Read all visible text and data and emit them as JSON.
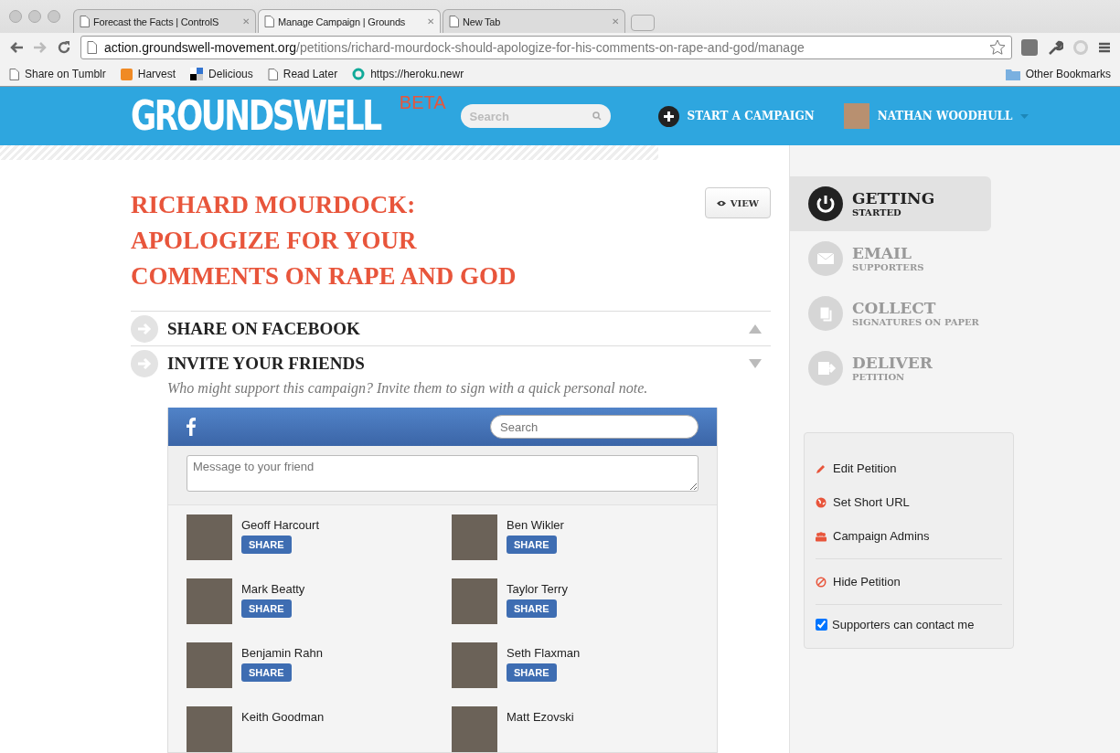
{
  "browser": {
    "tabs": [
      {
        "title": "Forecast the Facts | ControlS",
        "selected": false,
        "close": "✕"
      },
      {
        "title": "Manage Campaign | Grounds",
        "selected": true,
        "close": "✕"
      },
      {
        "title": "New Tab",
        "selected": false,
        "close": "✕"
      }
    ],
    "url": {
      "host": "action.groundswell-movement.org",
      "path": "/petitions/richard-mourdock-should-apologize-for-his-comments-on-rape-and-god/manage"
    },
    "bookmarks": [
      {
        "label": "Share on Tumblr",
        "kind": "page"
      },
      {
        "label": "Harvest",
        "kind": "harvest"
      },
      {
        "label": "Delicious",
        "kind": "delicious"
      },
      {
        "label": "Read Later",
        "kind": "page"
      },
      {
        "label": "https://heroku.newr",
        "kind": "globe"
      }
    ],
    "other_bookmarks": "Other Bookmarks"
  },
  "header": {
    "logo": "GROUNDSWELL",
    "badge": "BETA",
    "search_placeholder": "Search",
    "start_campaign": "START A CAMPAIGN",
    "user": "NATHAN WOODHULL"
  },
  "petition": {
    "title": "RICHARD MOURDOCK: APOLOGIZE FOR YOUR COMMENTS ON RAPE AND GOD",
    "view_button": "VIEW",
    "sections": [
      {
        "title": "SHARE ON FACEBOOK",
        "expanded": false
      },
      {
        "title": "INVITE YOUR FRIENDS",
        "expanded": true
      }
    ],
    "invite_prompt": "Who might support this campaign? Invite them to sign with a quick personal note.",
    "facebook": {
      "search_placeholder": "Search",
      "message_placeholder": "Message to your friend",
      "friends": [
        {
          "name": "Geoff Harcourt",
          "button": "SHARE"
        },
        {
          "name": "Ben Wikler",
          "button": "SHARE"
        },
        {
          "name": "Mark Beatty",
          "button": "SHARE"
        },
        {
          "name": "Taylor Terry",
          "button": "SHARE"
        },
        {
          "name": "Benjamin Rahn",
          "button": "SHARE"
        },
        {
          "name": "Seth Flaxman",
          "button": "SHARE"
        },
        {
          "name": "Keith Goodman"
        },
        {
          "name": "Matt Ezovski"
        }
      ]
    }
  },
  "steps": [
    {
      "title": "GETTING",
      "subtitle": "STARTED",
      "kind": "power",
      "selected": true
    },
    {
      "title": "EMAIL",
      "subtitle": "SUPPORTERS",
      "kind": "mail",
      "selected": false
    },
    {
      "title": "COLLECT",
      "subtitle": "SIGNATURES ON PAPER",
      "kind": "pages",
      "selected": false
    },
    {
      "title": "DELIVER",
      "subtitle": "PETITION",
      "kind": "deliver",
      "selected": false
    }
  ],
  "actions": [
    [
      {
        "label": "Edit Petition",
        "kind": "pencil"
      },
      {
        "label": "Set Short URL",
        "kind": "globe"
      },
      {
        "label": "Campaign Admins",
        "kind": "people"
      }
    ],
    [
      {
        "label": "Hide Petition",
        "kind": "ban"
      }
    ]
  ],
  "contact_option": {
    "label": "Supporters can contact me",
    "checked": true
  }
}
